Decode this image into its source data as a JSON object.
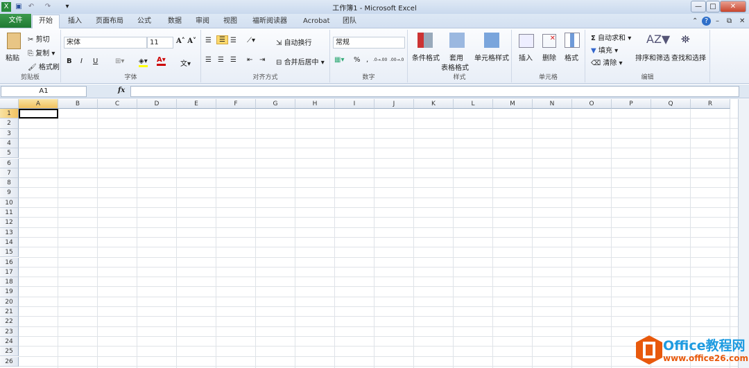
{
  "window": {
    "title": "工作簿1 - Microsoft Excel"
  },
  "quick_access": {
    "save": "save-icon",
    "undo": "undo-icon",
    "redo": "redo-icon"
  },
  "tabs": [
    "文件",
    "开始",
    "插入",
    "页面布局",
    "公式",
    "数据",
    "审阅",
    "视图",
    "福昕阅读器",
    "Acrobat",
    "团队"
  ],
  "ribbon": {
    "clipboard": {
      "label": "剪贴板",
      "paste": "粘贴",
      "cut": "剪切",
      "copy": "复制",
      "format_painter": "格式刷"
    },
    "font": {
      "label": "字体",
      "font_name": "宋体",
      "font_size": "11",
      "bold": "B",
      "italic": "I",
      "underline": "U"
    },
    "alignment": {
      "label": "对齐方式",
      "wrap": "自动换行",
      "merge": "合并后居中"
    },
    "number": {
      "label": "数字",
      "format": "常规",
      "percent": "%",
      "comma": ",",
      "inc": ".0→.00",
      "dec": ".00→.0"
    },
    "styles": {
      "label": "样式",
      "conditional": "条件格式",
      "table1": "套用",
      "table2": "表格格式",
      "cell_styles": "单元格样式"
    },
    "cells": {
      "label": "单元格",
      "insert": "插入",
      "delete": "删除",
      "format": "格式"
    },
    "editing": {
      "label": "编辑",
      "autosum": "自动求和",
      "fill": "填充",
      "clear": "清除",
      "sort": "排序和筛选",
      "find": "查找和选择"
    }
  },
  "formula_bar": {
    "name_box": "A1",
    "fx": "fx",
    "value": ""
  },
  "sheet": {
    "columns": [
      "A",
      "B",
      "C",
      "D",
      "E",
      "F",
      "G",
      "H",
      "I",
      "J",
      "K",
      "L",
      "M",
      "N",
      "O",
      "P",
      "Q",
      "R"
    ],
    "rows": 26,
    "selected": "A1"
  },
  "watermark": {
    "brand": "Office教程网",
    "url": "www.office26.com"
  },
  "colors": {
    "file_tab": "#2a8a3e",
    "accent_orange": "#e8590c",
    "logo_blue": "#1e9be0"
  }
}
